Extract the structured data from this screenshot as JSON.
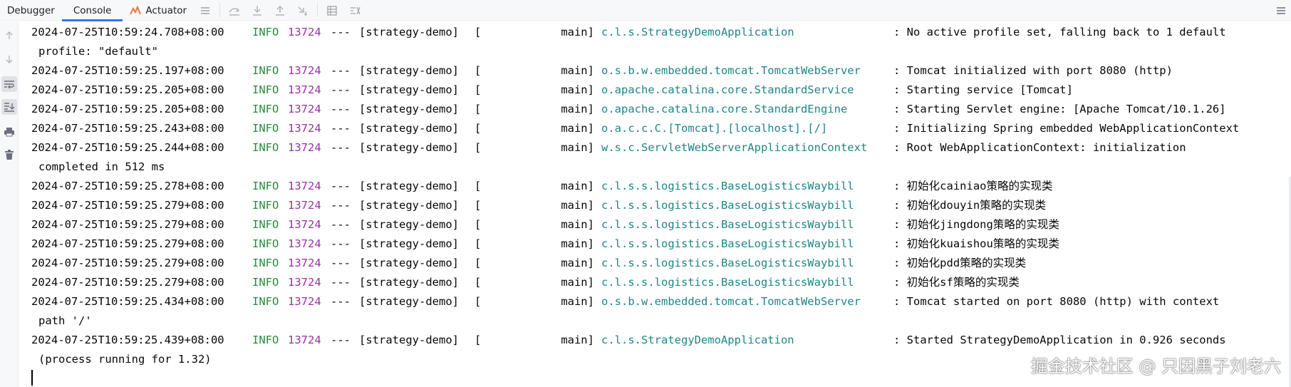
{
  "tabs": [
    {
      "label": "Debugger",
      "active": false
    },
    {
      "label": "Console",
      "active": true
    },
    {
      "label": "Actuator",
      "active": false
    }
  ],
  "toolbar_icons": [
    "menu-icon",
    "step-over-icon",
    "step-into-icon",
    "step-out-icon",
    "run-to-cursor-icon",
    "table-icon",
    "evaluate-icon"
  ],
  "gutter_icons": [
    "up-arrow-icon",
    "down-arrow-icon",
    "soft-wrap-icon",
    "scroll-to-end-icon",
    "print-icon",
    "trash-icon"
  ],
  "colors": {
    "info": "#2b8a3e",
    "pid": "#9b30a6",
    "logger": "#1f8585",
    "accent": "#3574f0"
  },
  "log": [
    {
      "ts": "2024-07-25T10:59:24.708+08:00",
      "level": "INFO",
      "pid": "13724",
      "sep": "---",
      "app": "[strategy-demo]",
      "thread": "[            main]",
      "logger": "c.l.s.StrategyDemoApplication",
      "msg": ": No active profile set, falling back to 1 default",
      "cont": "profile: \"default\""
    },
    {
      "ts": "2024-07-25T10:59:25.197+08:00",
      "level": "INFO",
      "pid": "13724",
      "sep": "---",
      "app": "[strategy-demo]",
      "thread": "[            main]",
      "logger": "o.s.b.w.embedded.tomcat.TomcatWebServer",
      "msg": ": Tomcat initialized with port 8080 (http)"
    },
    {
      "ts": "2024-07-25T10:59:25.205+08:00",
      "level": "INFO",
      "pid": "13724",
      "sep": "---",
      "app": "[strategy-demo]",
      "thread": "[            main]",
      "logger": "o.apache.catalina.core.StandardService",
      "msg": ": Starting service [Tomcat]"
    },
    {
      "ts": "2024-07-25T10:59:25.205+08:00",
      "level": "INFO",
      "pid": "13724",
      "sep": "---",
      "app": "[strategy-demo]",
      "thread": "[            main]",
      "logger": "o.apache.catalina.core.StandardEngine",
      "msg": ": Starting Servlet engine: [Apache Tomcat/10.1.26]"
    },
    {
      "ts": "2024-07-25T10:59:25.243+08:00",
      "level": "INFO",
      "pid": "13724",
      "sep": "---",
      "app": "[strategy-demo]",
      "thread": "[            main]",
      "logger": "o.a.c.c.C.[Tomcat].[localhost].[/]",
      "msg": ": Initializing Spring embedded WebApplicationContext"
    },
    {
      "ts": "2024-07-25T10:59:25.244+08:00",
      "level": "INFO",
      "pid": "13724",
      "sep": "---",
      "app": "[strategy-demo]",
      "thread": "[            main]",
      "logger": "w.s.c.ServletWebServerApplicationContext",
      "msg": ": Root WebApplicationContext: initialization",
      "cont": "completed in 512 ms"
    },
    {
      "ts": "2024-07-25T10:59:25.278+08:00",
      "level": "INFO",
      "pid": "13724",
      "sep": "---",
      "app": "[strategy-demo]",
      "thread": "[            main]",
      "logger": "c.l.s.s.logistics.BaseLogisticsWaybill",
      "msg": ": 初始化cainiao策略的实现类"
    },
    {
      "ts": "2024-07-25T10:59:25.279+08:00",
      "level": "INFO",
      "pid": "13724",
      "sep": "---",
      "app": "[strategy-demo]",
      "thread": "[            main]",
      "logger": "c.l.s.s.logistics.BaseLogisticsWaybill",
      "msg": ": 初始化douyin策略的实现类"
    },
    {
      "ts": "2024-07-25T10:59:25.279+08:00",
      "level": "INFO",
      "pid": "13724",
      "sep": "---",
      "app": "[strategy-demo]",
      "thread": "[            main]",
      "logger": "c.l.s.s.logistics.BaseLogisticsWaybill",
      "msg": ": 初始化jingdong策略的实现类"
    },
    {
      "ts": "2024-07-25T10:59:25.279+08:00",
      "level": "INFO",
      "pid": "13724",
      "sep": "---",
      "app": "[strategy-demo]",
      "thread": "[            main]",
      "logger": "c.l.s.s.logistics.BaseLogisticsWaybill",
      "msg": ": 初始化kuaishou策略的实现类"
    },
    {
      "ts": "2024-07-25T10:59:25.279+08:00",
      "level": "INFO",
      "pid": "13724",
      "sep": "---",
      "app": "[strategy-demo]",
      "thread": "[            main]",
      "logger": "c.l.s.s.logistics.BaseLogisticsWaybill",
      "msg": ": 初始化pdd策略的实现类"
    },
    {
      "ts": "2024-07-25T10:59:25.279+08:00",
      "level": "INFO",
      "pid": "13724",
      "sep": "---",
      "app": "[strategy-demo]",
      "thread": "[            main]",
      "logger": "c.l.s.s.logistics.BaseLogisticsWaybill",
      "msg": ": 初始化sf策略的实现类"
    },
    {
      "ts": "2024-07-25T10:59:25.434+08:00",
      "level": "INFO",
      "pid": "13724",
      "sep": "---",
      "app": "[strategy-demo]",
      "thread": "[            main]",
      "logger": "o.s.b.w.embedded.tomcat.TomcatWebServer",
      "msg": ": Tomcat started on port 8080 (http) with context",
      "cont": "path '/'"
    },
    {
      "ts": "2024-07-25T10:59:25.439+08:00",
      "level": "INFO",
      "pid": "13724",
      "sep": "---",
      "app": "[strategy-demo]",
      "thread": "[            main]",
      "logger": "c.l.s.StrategyDemoApplication",
      "msg": ": Started StrategyDemoApplication in 0.926 seconds",
      "cont": "(process running for 1.32)"
    }
  ],
  "watermark": "掘金技术社区 @ 只因黑子刘老六"
}
